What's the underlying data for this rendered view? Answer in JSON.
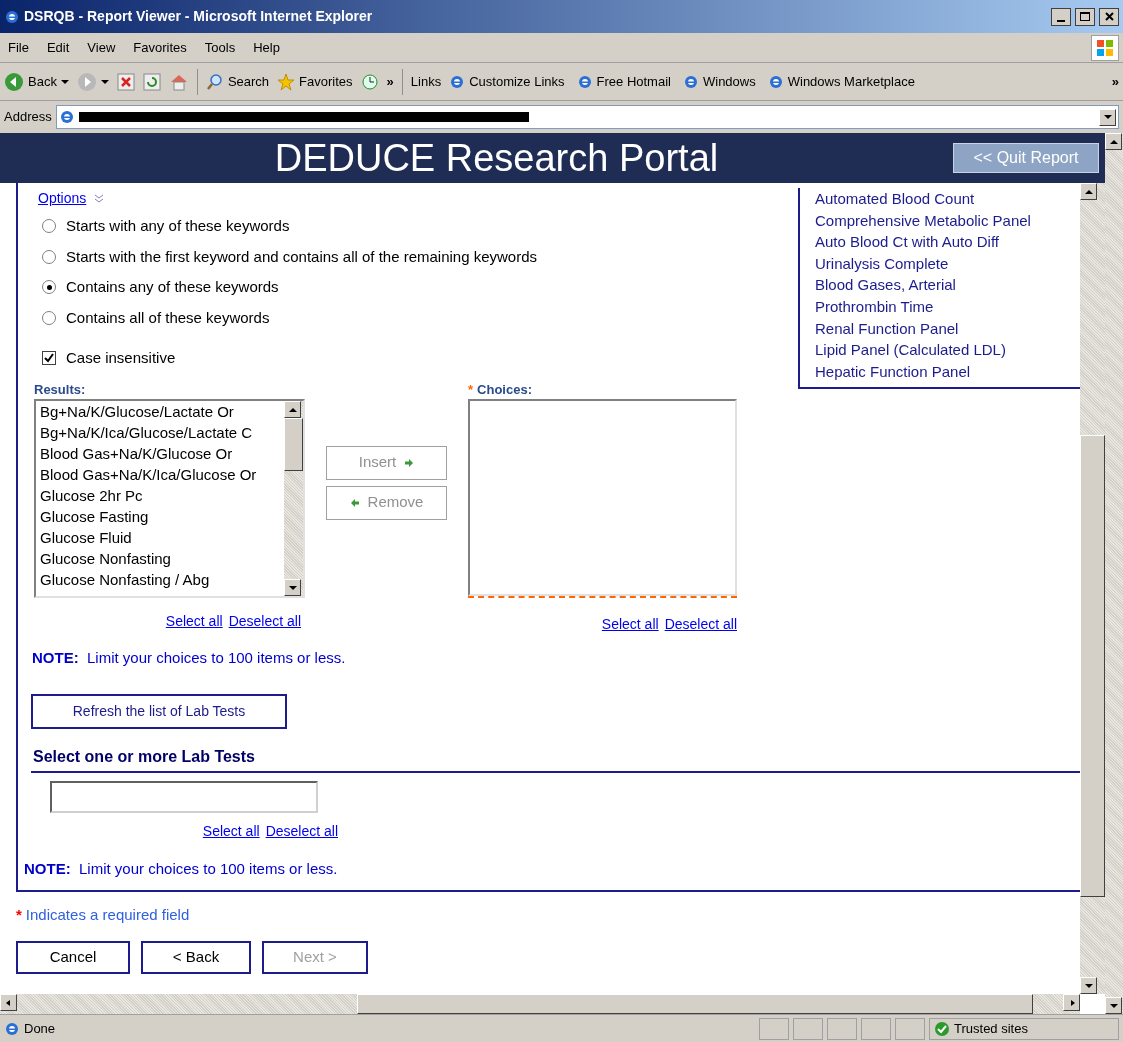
{
  "window": {
    "title": "DSRQB - Report Viewer - Microsoft Internet Explorer"
  },
  "menu": [
    "File",
    "Edit",
    "View",
    "Favorites",
    "Tools",
    "Help"
  ],
  "toolbar": {
    "back": "Back",
    "search": "Search",
    "favorites": "Favorites",
    "chevron": "»",
    "links_label": "Links",
    "links": [
      "Customize Links",
      "Free Hotmail",
      "Windows",
      "Windows Marketplace"
    ],
    "links_chevron": "»"
  },
  "address": {
    "label": "Address"
  },
  "header": {
    "title": "DEDUCE Research Portal",
    "quit": "<< Quit Report"
  },
  "options": {
    "label": "Options"
  },
  "match_modes": [
    {
      "label": "Starts with any of these keywords",
      "selected": false
    },
    {
      "label": "Starts with the first keyword and contains all of the remaining keywords",
      "selected": false
    },
    {
      "label": "Contains any of these keywords",
      "selected": true
    },
    {
      "label": "Contains all of these keywords",
      "selected": false
    }
  ],
  "case_insensitive": {
    "label": "Case insensitive",
    "checked": true
  },
  "results": {
    "label": "Results:",
    "items": [
      "Bg+Na/K/Glucose/Lactate Or",
      "Bg+Na/K/Ica/Glucose/Lactate C",
      "Blood Gas+Na/K/Glucose Or",
      "Blood Gas+Na/K/Ica/Glucose Or",
      "Glucose 2hr Pc",
      "Glucose Fasting",
      "Glucose Fluid",
      "Glucose Nonfasting",
      "Glucose Nonfasting / Abg"
    ],
    "select_all": "Select all",
    "deselect_all": "Deselect all"
  },
  "transfer_buttons": [
    {
      "label": "Insert",
      "kind": "insert",
      "disabled": true
    },
    {
      "label": "Remove",
      "kind": "remove",
      "disabled": true
    }
  ],
  "choices": {
    "required_mark": "*",
    "label": "Choices:",
    "select_all": "Select all",
    "deselect_all": "Deselect all"
  },
  "note_1": "**NOTE:**  Limit your choices to 100 items or less.",
  "popular_tests": [
    "Automated Blood Count",
    "Comprehensive Metabolic Panel",
    "Auto Blood Ct with Auto Diff",
    "Urinalysis Complete",
    "Blood Gases, Arterial",
    "Prothrombin Time",
    "Renal Function Panel",
    "Lipid Panel (Calculated LDL)",
    "Hepatic Function Panel"
  ],
  "refresh_button": "Refresh the list of Lab Tests",
  "lab_tests": {
    "heading": "Select one or more Lab Tests",
    "select_all": "Select all",
    "deselect_all": "Deselect all"
  },
  "note_2": "**NOTE:**  Limit your choices to 100 items or less.",
  "required_note": {
    "mark": "*",
    "text": "Indicates a required field"
  },
  "nav_buttons": [
    {
      "label": "Cancel",
      "disabled": false
    },
    {
      "label": "< Back",
      "disabled": false
    },
    {
      "label": "Next >",
      "disabled": true
    }
  ],
  "status_bar": {
    "text": "Done",
    "zone": "Trusted sites"
  }
}
